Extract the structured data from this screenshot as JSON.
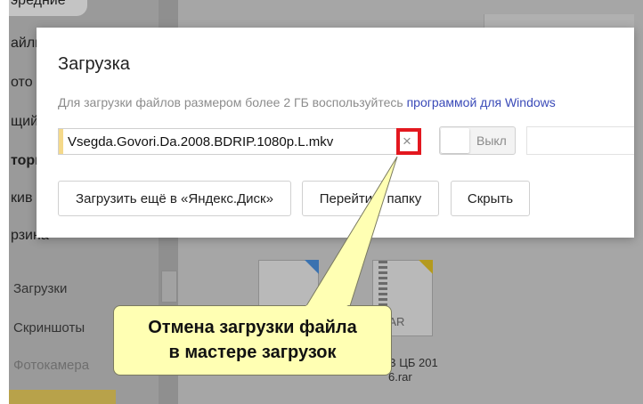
{
  "background": {
    "sidebar_fragments": [
      "эредние",
      "айлы",
      "ото",
      "щий",
      "тори",
      "кив",
      "рзина"
    ],
    "sidebar_items": [
      {
        "label": "Загрузки",
        "dim": false
      },
      {
        "label": "Скриншоты",
        "dim": false
      },
      {
        "label": "Фотокамера",
        "dim": true
      }
    ],
    "files": [
      {
        "ext": "",
        "icon": "audio-file-icon"
      },
      {
        "ext": "RAR",
        "icon": "archive-file-icon",
        "caption_line1": "В ЦБ 201",
        "caption_line2": "6.rar"
      }
    ]
  },
  "modal": {
    "title": "Загрузка",
    "note_text": "Для загрузки файлов размером более 2 ГБ воспользуйтесь ",
    "note_link": "программой для Windows",
    "file_name": "Vsegda.Govori.Da.2008.BDRIP.1080p.L.mkv",
    "cancel_icon": "×",
    "toggle_label": "Выкл",
    "buttons": {
      "upload_more": "Загрузить ещё в «Яндекс.Диск»",
      "go_to_folder": "Перейти в папку",
      "hide": "Скрыть"
    }
  },
  "callout": {
    "line1": "Отмена загрузки файла",
    "line2": "в мастере загрузок"
  },
  "colors": {
    "highlight": "#e3181f",
    "callout_fill": "#ffffb3",
    "link": "#3a4ab8"
  }
}
